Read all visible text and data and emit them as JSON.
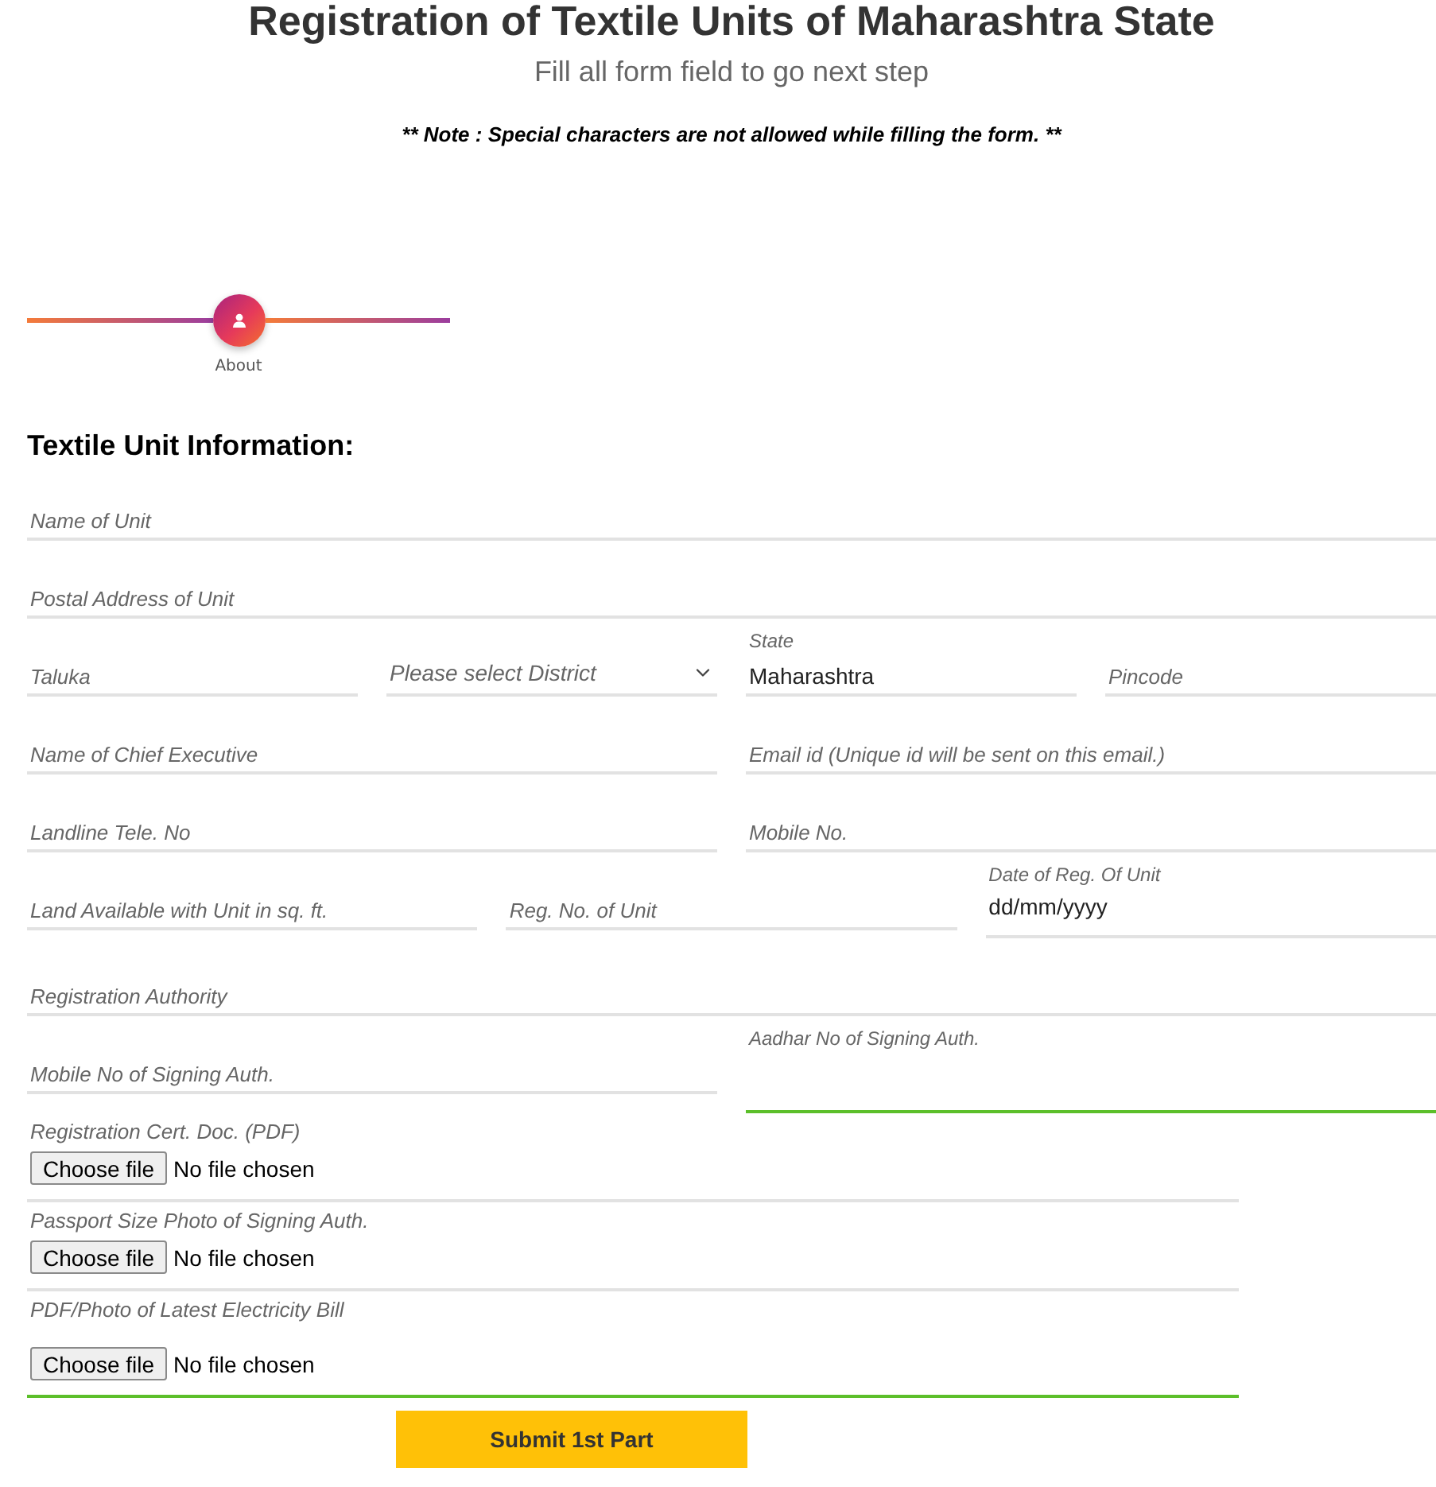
{
  "header": {
    "title": "Registration of Textile Units of Maharashtra State",
    "subtitle": "Fill all form field to go next step",
    "note": "** Note : Special characters are not allowed while filling the form. **"
  },
  "stepper": {
    "steps": [
      {
        "label": "About",
        "selected": true
      }
    ]
  },
  "section": {
    "title": "Textile Unit Information:"
  },
  "form_rows": [
    {
      "fields": [
        {
          "kind": "text",
          "placeholder": "Name of Unit",
          "valid": false
        }
      ]
    },
    {
      "fields": [
        {
          "kind": "text",
          "placeholder": "Postal Address of Unit",
          "valid": false
        }
      ]
    },
    {
      "fields": [
        {
          "kind": "text",
          "placeholder": "Taluka",
          "valid": false
        },
        {
          "kind": "select",
          "placeholder": "Please select District",
          "valid": false
        },
        {
          "kind": "text",
          "label": "State",
          "value": "Maharashtra",
          "valid": false
        },
        {
          "kind": "text",
          "placeholder": "Pincode",
          "valid": false
        }
      ]
    },
    {
      "fields": [
        {
          "kind": "text",
          "placeholder": "Name of Chief Executive",
          "valid": false
        },
        {
          "kind": "text",
          "placeholder": "Email id (Unique id will be sent on this email.)",
          "valid": false
        }
      ]
    },
    {
      "fields": [
        {
          "kind": "text",
          "placeholder": "Landline Tele. No",
          "valid": false
        },
        {
          "kind": "text",
          "placeholder": "Mobile No.",
          "valid": false
        }
      ]
    },
    {
      "fields": [
        {
          "kind": "text",
          "placeholder": "Land Available with Unit in sq. ft.",
          "valid": false
        },
        {
          "kind": "text",
          "placeholder": "Reg. No. of Unit",
          "valid": false
        },
        {
          "kind": "date",
          "label": "Date of Reg. Of Unit",
          "value": "dd/mm/yyyy",
          "valid": false
        }
      ]
    },
    {
      "fields": [
        {
          "kind": "text",
          "placeholder": "Registration Authority",
          "valid": false
        }
      ]
    },
    {
      "fields": [
        {
          "kind": "text",
          "placeholder": "Mobile No of Signing Auth.",
          "valid": false
        },
        {
          "kind": "text",
          "label": "Aadhar No of Signing Auth.",
          "valid": true
        }
      ]
    }
  ],
  "uploads": [
    {
      "label": "Registration Cert. Doc. (PDF)",
      "button": "Choose file",
      "status": "No file chosen",
      "valid": false
    },
    {
      "label": "Passport Size Photo of Signing Auth.",
      "button": "Choose file",
      "status": "No file chosen",
      "valid": false
    },
    {
      "label": "PDF/Photo of Latest Electricity Bill",
      "button": "Choose file",
      "status": "No file chosen",
      "valid": true
    }
  ],
  "submit": {
    "label": "Submit 1st Part"
  }
}
